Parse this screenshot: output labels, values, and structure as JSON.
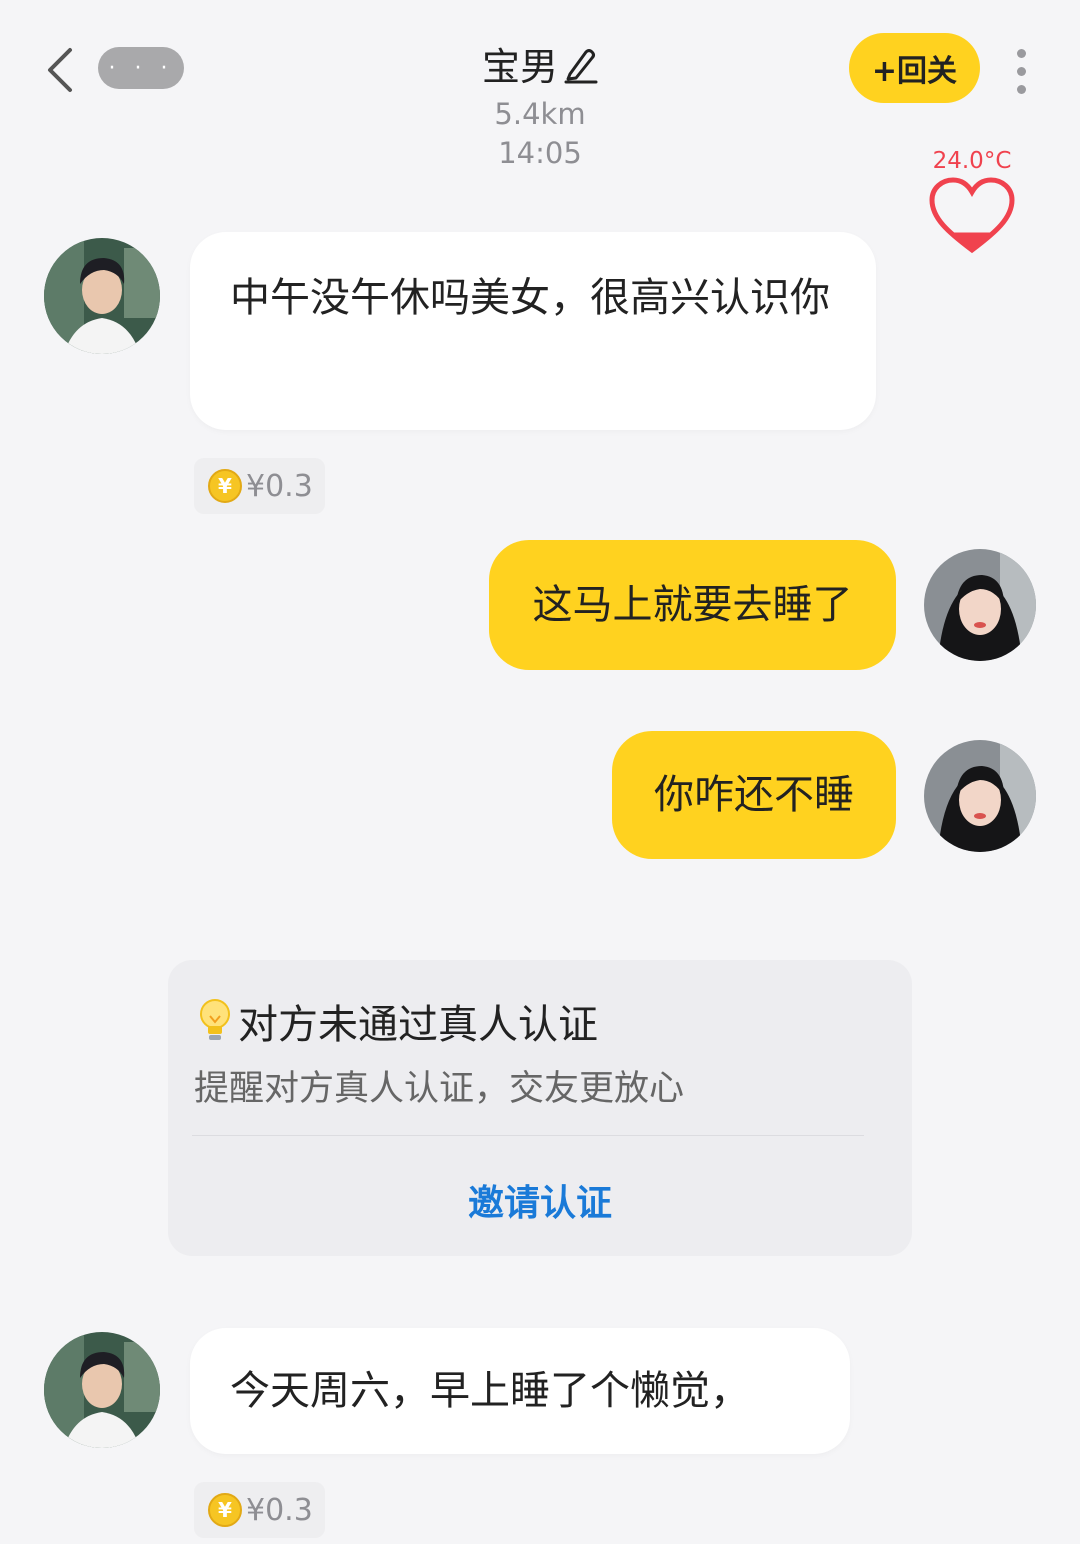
{
  "header": {
    "more_dots": "· · ·",
    "contact_name": "宝男",
    "distance": "5.4km",
    "follow_label": "+回关"
  },
  "timestamp": "14:05",
  "intimacy": {
    "temperature": "24.0°C",
    "level": 0.25
  },
  "messages": [
    {
      "direction": "incoming",
      "text": "中午没午休吗美女，很高兴认识你",
      "cost": "¥0.3",
      "coin_symbol": "¥"
    },
    {
      "direction": "outgoing",
      "text": "这马上就要去睡了"
    },
    {
      "direction": "outgoing",
      "text": "你咋还不睡"
    },
    {
      "direction": "incoming",
      "text": "今天周六，早上睡了个懒觉，",
      "cost": "¥0.3",
      "coin_symbol": "¥"
    }
  ],
  "verification": {
    "title": "对方未通过真人认证",
    "description": "提醒对方真人认证，交友更放心",
    "action_label": "邀请认证"
  },
  "colors": {
    "accent_yellow": "#ffd21f",
    "link_blue": "#1a7ad8",
    "temperature_red": "#f0424e",
    "background": "#f5f5f7"
  },
  "icons": {
    "back": "chevron-left-icon",
    "edit": "pencil-icon",
    "more": "vertical-dots-icon",
    "heart": "heart-icon",
    "coin": "coin-icon",
    "tip": "lightbulb-icon"
  }
}
